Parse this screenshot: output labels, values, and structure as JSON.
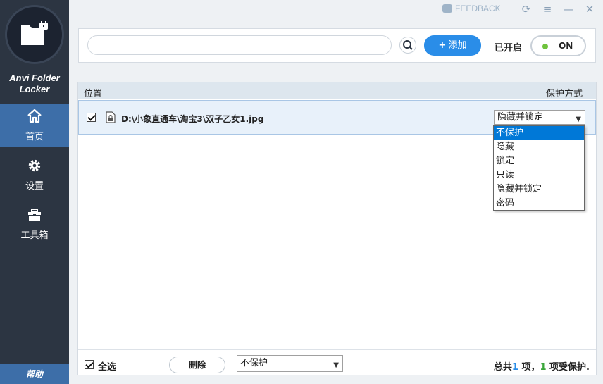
{
  "app": {
    "brand": "Anvi Folder Locker",
    "brand_line1": "Anvi Folder",
    "brand_line2": "Locker",
    "accent_color": "#2a8de8",
    "sidebar_color": "#2c3542"
  },
  "titlebar": {
    "feedback_label": "FEEDBACK",
    "icons": [
      "refresh-icon",
      "menu-icon",
      "minimize-icon",
      "close-icon"
    ]
  },
  "sidebar": {
    "items": [
      {
        "label": "首页",
        "icon": "home-icon",
        "active": true
      },
      {
        "label": "设置",
        "icon": "gear-icon",
        "active": false
      },
      {
        "label": "工具箱",
        "icon": "toolbox-icon",
        "active": false
      }
    ],
    "help_label": "帮助"
  },
  "toolbar": {
    "search_value": "",
    "add_label": "添加",
    "status_label": "已开启",
    "toggle_label": "ON"
  },
  "list": {
    "header_location": "位置",
    "header_protection": "保护方式",
    "rows": [
      {
        "checked": true,
        "path": "D:\\小象直通车\\淘宝3\\双子乙女1.jpg",
        "protection": "隐藏并锁定"
      }
    ]
  },
  "dropdown": {
    "options": [
      "不保护",
      "隐藏",
      "锁定",
      "只读",
      "隐藏并锁定",
      "密码"
    ],
    "highlighted": "不保护"
  },
  "footer": {
    "select_all_label": "全选",
    "delete_label": "删除",
    "bulk_protection": "不保护",
    "summary_prefix": "总共",
    "total_count": "1",
    "summary_mid": " 项，",
    "protected_count": "1",
    "summary_suffix": " 项受保护."
  }
}
